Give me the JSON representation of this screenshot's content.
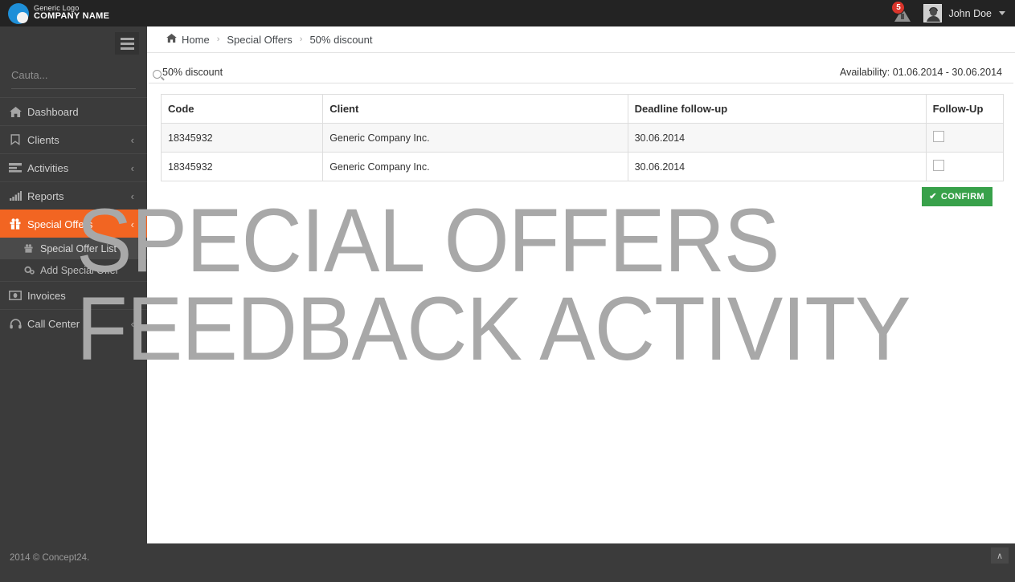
{
  "topbar": {
    "logo": {
      "line1": "Generic Logo",
      "line2": "COMPANY NAME",
      "icon": "circle-logo-icon"
    },
    "alert": {
      "icon": "warning-triangle-icon",
      "count": "5"
    },
    "user": {
      "name": "John Doe",
      "avatar_icon": "user-avatar",
      "caret_icon": "chevron-down-icon"
    }
  },
  "sidebar": {
    "toggle_icon": "hamburger-menu-icon",
    "search": {
      "placeholder": "Cauta...",
      "value": "",
      "icon": "search-icon"
    },
    "items": [
      {
        "label": "Dashboard",
        "icon": "home-icon",
        "arrow": "",
        "active": false
      },
      {
        "label": "Clients",
        "icon": "bookmark-icon",
        "arrow": "‹",
        "active": false
      },
      {
        "label": "Activities",
        "icon": "list-icon",
        "arrow": "‹",
        "active": false
      },
      {
        "label": "Reports",
        "icon": "bar-chart-icon",
        "arrow": "‹",
        "active": false
      },
      {
        "label": "Special Offers",
        "icon": "gift-icon",
        "arrow": "‹",
        "active": true
      },
      {
        "label": "Invoices",
        "icon": "money-icon",
        "arrow": "",
        "active": false
      },
      {
        "label": "Call Center",
        "icon": "headset-icon",
        "arrow": "‹",
        "active": false
      }
    ],
    "submenu": [
      {
        "label": "Special Offer List",
        "icon": "gift-icon",
        "current": true
      },
      {
        "label": "Add Special Offer",
        "icon": "gears-icon",
        "current": false
      }
    ],
    "footer": "2014 © Concept24."
  },
  "breadcrumb": {
    "home_icon": "home-icon",
    "home": "Home",
    "sep": "›",
    "section": "Special Offers",
    "current": "50% discount"
  },
  "page": {
    "title": "50% discount",
    "availability": "Availability: 01.06.2014 - 30.06.2014"
  },
  "table": {
    "headers": [
      "Code",
      "Client",
      "Deadline follow-up",
      "Follow-Up"
    ],
    "rows": [
      {
        "code": "18345932",
        "client": "Generic Company Inc.",
        "deadline": "30.06.2014",
        "follow_up_checked": false
      },
      {
        "code": "18345932",
        "client": "Generic Company Inc.",
        "deadline": "30.06.2014",
        "follow_up_checked": false
      }
    ]
  },
  "confirm_button": {
    "label": "CONFIRM",
    "icon": "check-icon",
    "color": "#38a14a"
  },
  "watermark": {
    "line1": "SPECIAL OFFERS",
    "line2": "FEEDBACK ACTIVITY",
    "color": "#a8a8a8"
  },
  "scroll_top": {
    "icon": "chevron-up-icon",
    "glyph": "∧"
  },
  "colors": {
    "accent": "#f26522",
    "sidebar": "#3b3b3b",
    "topbar": "#232323",
    "success": "#38a14a",
    "badge": "#d9342b"
  }
}
